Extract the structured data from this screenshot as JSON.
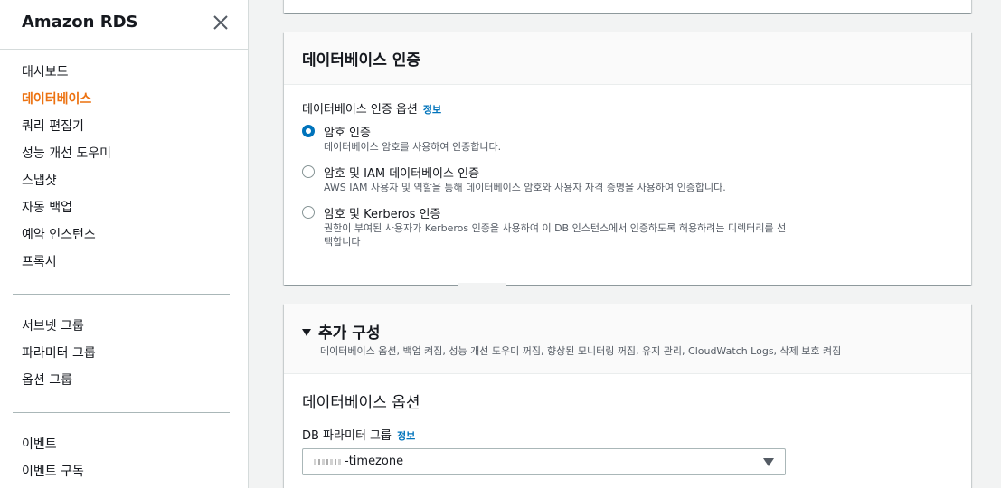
{
  "sidebar": {
    "title": "Amazon RDS",
    "close_icon": "close-icon",
    "items": [
      {
        "label": "대시보드"
      },
      {
        "label": "데이터베이스",
        "active": true
      },
      {
        "label": "쿼리 편집기"
      },
      {
        "label": "성능 개선 도우미"
      },
      {
        "label": "스냅샷"
      },
      {
        "label": "자동 백업"
      },
      {
        "label": "예약 인스턴스"
      },
      {
        "label": "프록시"
      },
      {
        "label": "서브넷 그룹"
      },
      {
        "label": "파라미터 그룹"
      },
      {
        "label": "옵션 그룹"
      },
      {
        "label": "이벤트"
      },
      {
        "label": "이벤트 구독"
      }
    ]
  },
  "auth_section": {
    "title": "데이터베이스 인증",
    "options_label": "데이터베이스 인증 옵션",
    "info_link": "정보",
    "options": [
      {
        "title": "암호 인증",
        "description": "데이터베이스 암호를 사용하여 인증합니다.",
        "selected": true
      },
      {
        "title": "암호 및 IAM 데이터베이스 인증",
        "description": "AWS IAM 사용자 및 역할을 통해 데이터베이스 암호와 사용자 자격 증명을 사용하여 인증합니다.",
        "selected": false
      },
      {
        "title": "암호 및 Kerberos 인증",
        "description": "권한이 부여된 사용자가 Kerberos 인증을 사용하여 이 DB 인스턴스에서 인증하도록 허용하려는 디렉터리를 선택합니다",
        "selected": false
      }
    ]
  },
  "extra_section": {
    "title": "추가 구성",
    "description": "데이터베이스 옵션, 백업 켜짐, 성능 개선 도우미 꺼짐, 향상된 모니터링 꺼짐, 유지 관리, CloudWatch Logs, 삭제 보호 켜짐",
    "db_options_title": "데이터베이스 옵션",
    "param_group_label": "DB 파라미터 그룹",
    "param_group_info": "정보",
    "param_group_value": "-timezone"
  },
  "colors": {
    "accent": "#0073bb",
    "active_nav": "#ec7211"
  }
}
